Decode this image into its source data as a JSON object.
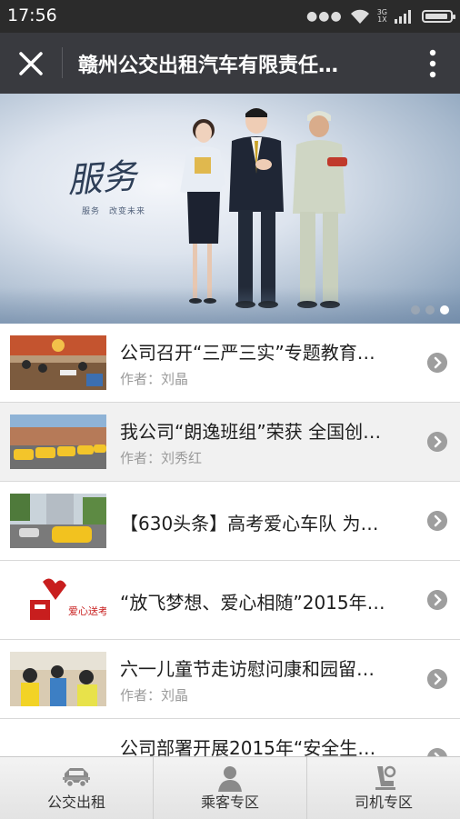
{
  "status_bar": {
    "time": "17:56",
    "network_top": "3G",
    "network_bottom": "1X"
  },
  "title_bar": {
    "title": "赣州公交出租汽车有限责任…"
  },
  "banner": {
    "slogan": "服务",
    "slogan_sub": "服务　改变未来",
    "slide_count": 3,
    "active_slide": 3
  },
  "articles": [
    {
      "title": "公司召开“三严三实”专题教育…",
      "author_label": "作者：刘晶",
      "thumb": "meeting-photo"
    },
    {
      "title": "我公司“朗逸班组”荣获 全国创…",
      "author_label": "作者：刘秀红",
      "thumb": "taxi-fleet-photo"
    },
    {
      "title": "【630头条】高考爱心车队 为…",
      "author_label": "",
      "thumb": "street-taxi-photo"
    },
    {
      "title": "“放飞梦想、爱心相随”2015年…",
      "author_label": "",
      "thumb": "love-exam-logo",
      "logo_text": "爱心送考"
    },
    {
      "title": "六一儿童节走访慰问康和园留…",
      "author_label": "作者：刘晶",
      "thumb": "children-photo"
    },
    {
      "title": "公司部署开展2015年“安全生…",
      "author_label": "",
      "thumb": "none"
    }
  ],
  "tabs": [
    {
      "label": "公交出租",
      "icon": "bus-taxi-icon"
    },
    {
      "label": "乘客专区",
      "icon": "passenger-icon"
    },
    {
      "label": "司机专区",
      "icon": "driver-seat-icon"
    }
  ],
  "colors": {
    "status_bar": "#2b2b2b",
    "title_bar": "#393a3f",
    "chevron": "#9e9e9e"
  }
}
